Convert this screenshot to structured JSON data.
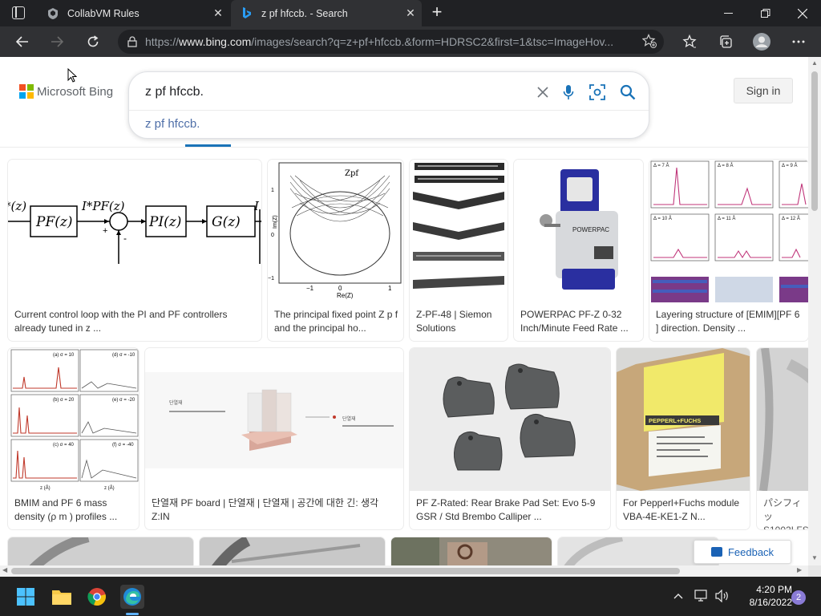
{
  "browser": {
    "tabs": [
      {
        "title": "CollabVM Rules"
      },
      {
        "title": "z pf hfccb. - Search"
      }
    ],
    "url_prefix": "https://",
    "url_domain": "www.bing.com",
    "url_rest": "/images/search?q=z+pf+hfccb.&form=HDRSC2&first=1&tsc=ImageHov..."
  },
  "page": {
    "brand": "Microsoft Bing",
    "query": "z pf hfccb.",
    "suggestion": "z pf hfccb.",
    "signin": "Sign in",
    "feedback": "Feedback"
  },
  "results": [
    {
      "caption": "Current control loop with the PI and PF controllers already tuned in z ..."
    },
    {
      "caption": "The principal fixed point Z p f and the principal ho..."
    },
    {
      "caption": "Z-PF-48 | Siemon Solutions"
    },
    {
      "caption": "POWERPAC PF-Z 0-32 Inch/Minute Feed Rate ..."
    },
    {
      "caption": "Layering structure of [EMIM][PF 6 ] direction. Density ..."
    },
    {
      "caption": "BMIM and PF 6 mass density (ρ m ) profiles ..."
    },
    {
      "caption": "단열재 PF board | 단열재 | 단열재 | 공간에 대한 긴: 생각 Z:IN"
    },
    {
      "caption": "PF Z-Rated: Rear Brake Pad Set: Evo 5-9 GSR / Std Brembo Calliper ..."
    },
    {
      "caption": "For Pepperl+Fuchs module VBA-4E-KE1-Z N..."
    },
    {
      "caption": "パシフィッ S1002LFS"
    }
  ],
  "image_text": {
    "block": {
      "pf": "PF(z)",
      "pi": "PI(z)",
      "g": "G(z)",
      "ipf": "I*PF(z)",
      "left": "*(z)",
      "right": "I"
    },
    "fixed": {
      "zpf": "Zpf",
      "ylab": "Im(Z)",
      "xlab": "Re(Z)",
      "tn1": "−1",
      "t0": "0",
      "t1": "1",
      "y1": "1",
      "y0": "0",
      "ym1": "−1"
    },
    "layer": {
      "p1": "Δ = 7 Å",
      "p2": "Δ = 8 Å",
      "p3": "Δ = 9 Å",
      "p4": "Δ = 10 Å",
      "p5": "Δ = 11 Å",
      "p6": "Δ = 12 Å"
    },
    "bmim": {
      "a": "(a) σ = 10",
      "d": "(d) σ = -10",
      "b": "(b) σ = 20",
      "e": "(e) σ = -20",
      "c": "(c) σ = 40",
      "f": "(f) σ = -40",
      "x": "z (Å)"
    },
    "pepperl_brand": "PEPPERL+FUCHS",
    "powerpac": "POWERPAC",
    "korean_label": "단열재"
  },
  "taskbar": {
    "time": "4:20 PM",
    "date": "8/16/2022",
    "notifications": "2"
  },
  "colors": {
    "tab_bg": "#202124",
    "active_tab": "#303134",
    "bing_blue": "#1a73b8",
    "link": "#4f6fa8",
    "ms_red": "#f25022",
    "ms_green": "#7fba00",
    "ms_blue": "#00a4ef",
    "ms_yellow": "#ffb900"
  }
}
